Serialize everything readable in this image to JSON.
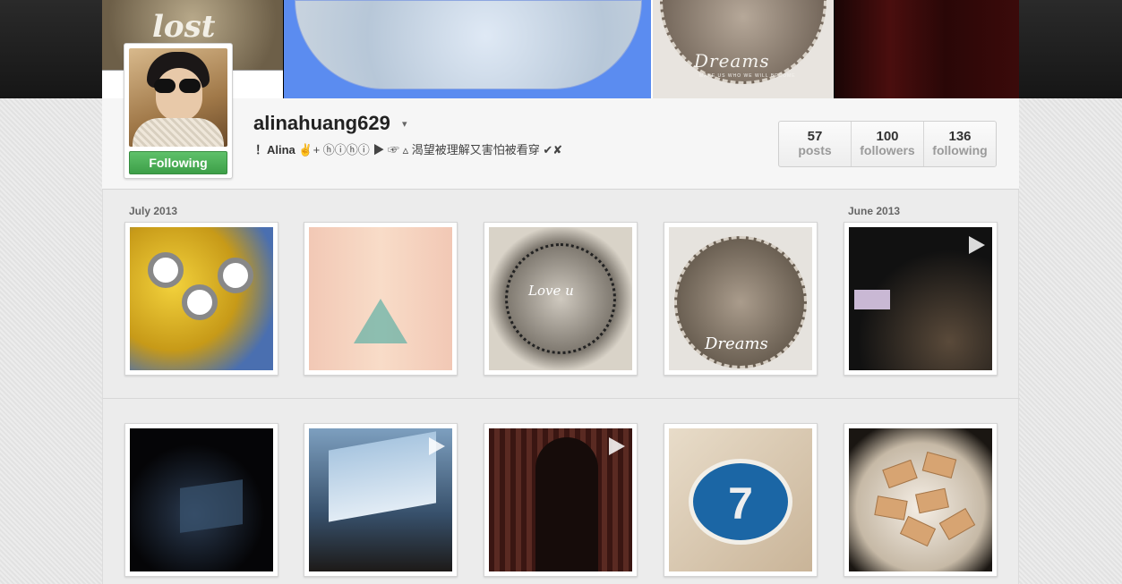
{
  "profile": {
    "username": "alinahuang629",
    "caret": "▾",
    "bio_name": "！Alina",
    "bio_rest": " ✌+ ⓗⓘⓗⓘ ▶ ☞ ▵ 渴望被理解又害怕被看穿 ✔✘",
    "follow_button": "Following"
  },
  "stats": [
    {
      "value": "57",
      "label": "posts"
    },
    {
      "value": "100",
      "label": "followers"
    },
    {
      "value": "136",
      "label": "following"
    }
  ],
  "banner": {
    "tile1_text": "lost",
    "tile3_text": "Dreams",
    "tile3_sub": "MAKE US WHO WE WILL BECOME"
  },
  "feed": {
    "month_1": "July 2013",
    "month_2": "June 2013",
    "photo_3_text": "Love u",
    "photo_4_text": "Dreams",
    "photo_9_text": "7"
  },
  "colors": {
    "follow_green": "#4cb056",
    "banner_blue": "#5b8cf0"
  }
}
